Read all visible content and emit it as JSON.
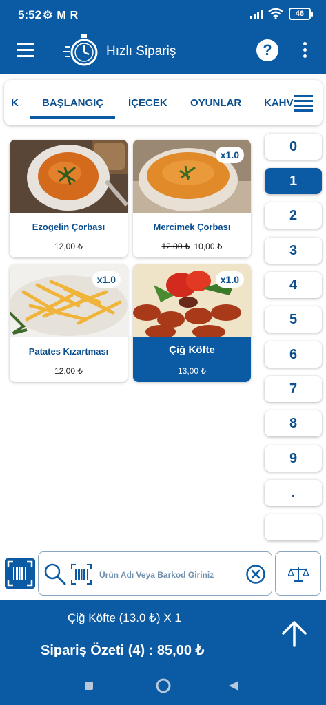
{
  "status_bar": {
    "time": "5:52",
    "left_icons": [
      "settings-icon",
      "gmail-icon",
      "r-app-icon"
    ],
    "battery": "46"
  },
  "app_bar": {
    "title": "Hızlı Sipariş",
    "help_label": "?"
  },
  "categories": {
    "tabs": [
      {
        "label": "K"
      },
      {
        "label": "BAŞLANGIÇ",
        "active": true
      },
      {
        "label": "İÇECEK"
      },
      {
        "label": "OYUNLAR"
      },
      {
        "label": "KAHV"
      }
    ]
  },
  "products": [
    {
      "name": "Ezogelin Çorbası",
      "price": "12,00 ₺",
      "old_price": "",
      "qty": ""
    },
    {
      "name": "Mercimek Çorbası",
      "price": "10,00 ₺",
      "old_price": "12,00 ₺",
      "qty": "x1.0"
    },
    {
      "name": "Patates Kızartması",
      "price": "12,00 ₺",
      "old_price": "",
      "qty": "x1.0"
    },
    {
      "name": "Çiğ Köfte",
      "price": "13,00 ₺",
      "old_price": "",
      "qty": "x1.0",
      "selected": true
    }
  ],
  "numpad": {
    "keys": [
      "0",
      "1",
      "2",
      "3",
      "4",
      "5",
      "6",
      "7",
      "8",
      "9",
      ".",
      ""
    ],
    "active": "1"
  },
  "search": {
    "placeholder": "Ürün Adı Veya Barkod Giriniz"
  },
  "footer": {
    "last_item": "Çiğ Köfte (13.0 ₺) X 1",
    "summary": "Sipariş Özeti (4) : 85,00 ₺"
  },
  "colors": {
    "primary": "#0b5aa4",
    "text_primary": "#0b4f8f"
  }
}
